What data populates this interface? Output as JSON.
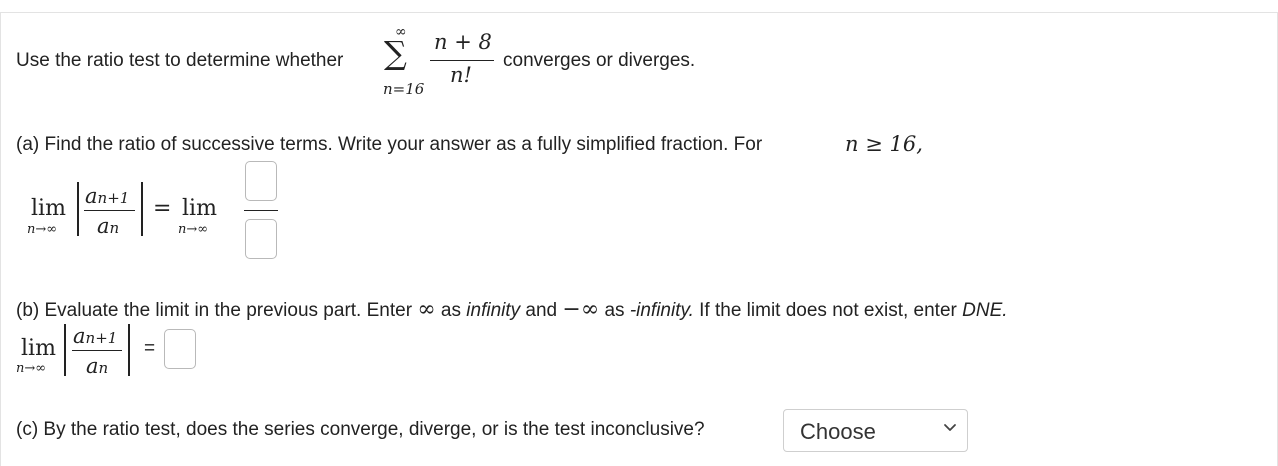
{
  "question": {
    "prompt_before": "Use the ratio test to determine whether",
    "prompt_after": "converges or diverges.",
    "series": {
      "sum_symbol": "∑",
      "upper": "∞",
      "lower": "n=16",
      "numerator": "n + 8",
      "denominator": "n!"
    }
  },
  "part_a": {
    "text": "(a) Find the ratio of successive terms. Write your answer as a fully simplified fraction. For",
    "condition": "n ≥ 16,",
    "lim": "lim",
    "lim_sub": "n→∞",
    "ratio_num": "a",
    "ratio_num_sub": "n+1",
    "ratio_den": "a",
    "ratio_den_sub": "n",
    "equals": "=",
    "lim2": "lim",
    "lim2_sub": "n→∞",
    "numerator_value": "",
    "denominator_value": ""
  },
  "part_b": {
    "text_1": "(b) Evaluate the limit in the previous part. Enter",
    "infinity_symbol": "∞",
    "text_2": "as",
    "infinity_word": "infinity",
    "text_3": "and",
    "neg_infinity_symbol": "−∞",
    "text_4": "as",
    "neg_infinity_word": "-infinity.",
    "text_5": "If the limit does not exist, enter",
    "dne": "DNE.",
    "lim": "lim",
    "lim_sub": "n→∞",
    "ratio_num": "a",
    "ratio_num_sub": "n+1",
    "ratio_den": "a",
    "ratio_den_sub": "n",
    "equals": "=",
    "answer_value": ""
  },
  "part_c": {
    "text": "(c) By the ratio test, does the series converge, diverge, or is the test inconclusive?",
    "select_value": "Choose",
    "chevron_icon": "chevron-down-icon"
  }
}
